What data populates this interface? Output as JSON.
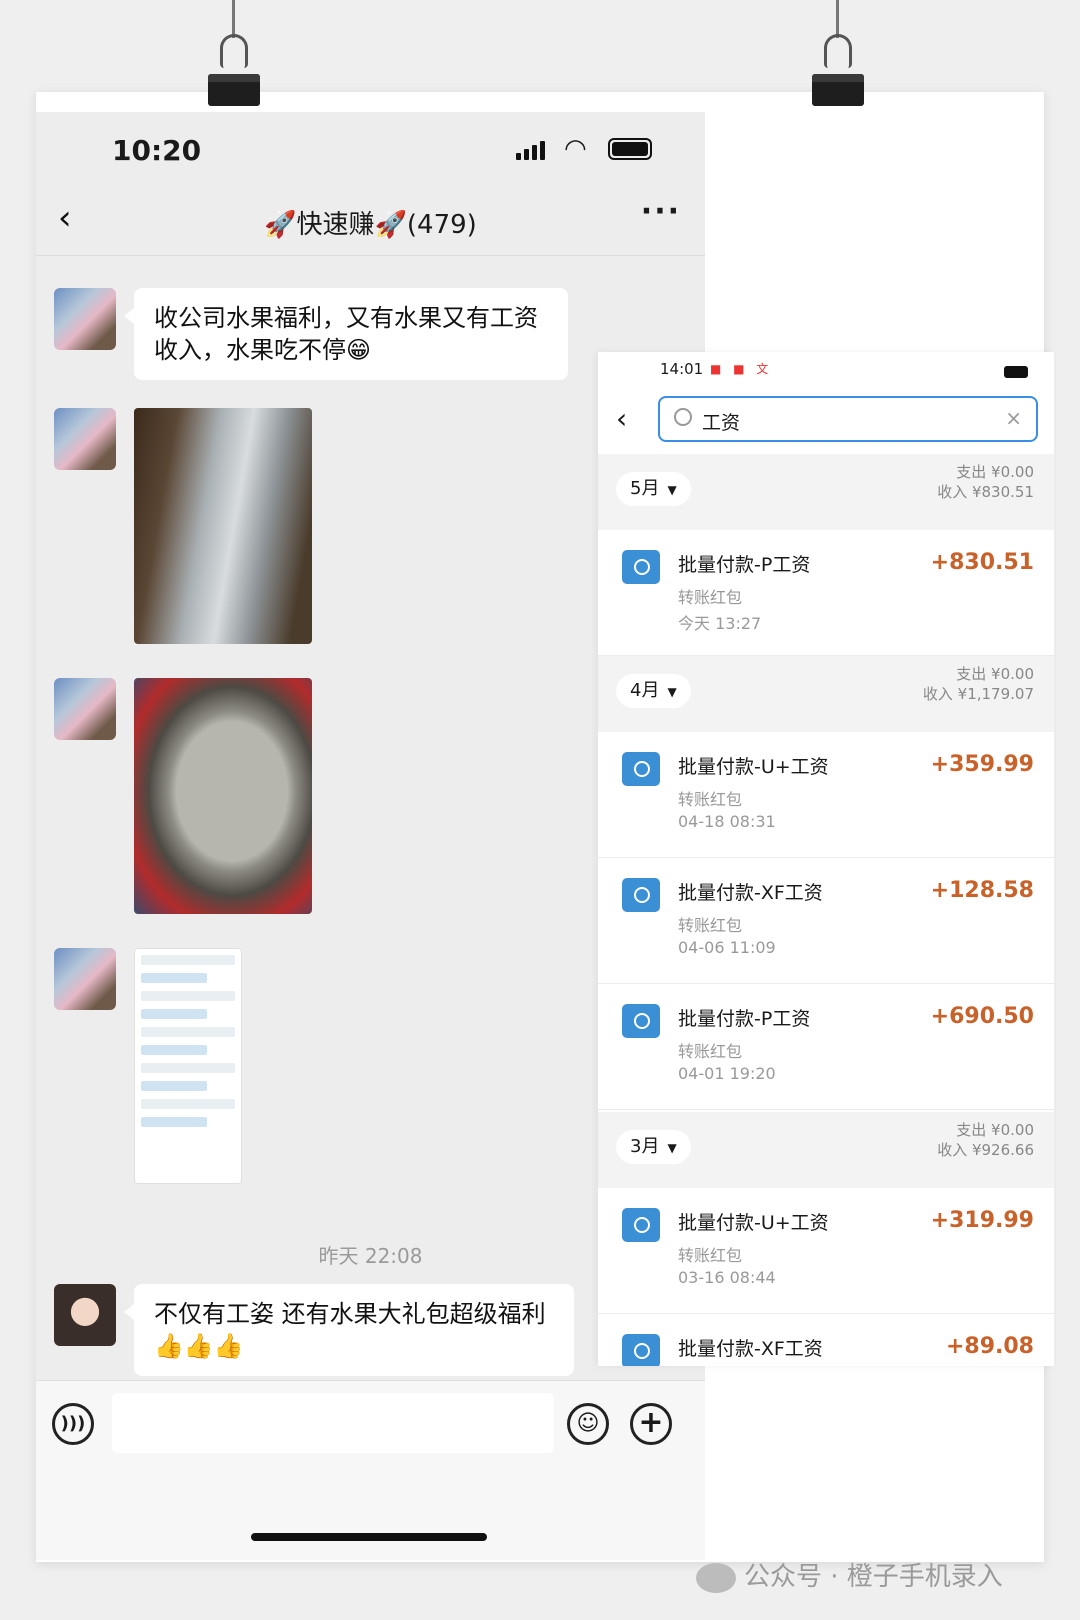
{
  "chat": {
    "status_time": "10:20",
    "group_title": "🚀快速赚🚀(479)",
    "messages": [
      {
        "text": "收公司水果福利，又有水果又有工资收入，水果吃不停😁"
      },
      {
        "text": "不仅有工姿 还有水果大礼包超级福利👍👍👍"
      }
    ],
    "timestamp": "昨天 22:08"
  },
  "wallet": {
    "status_time": "14:01",
    "search_value": "工资",
    "months": [
      {
        "label": "5月",
        "expense": "支出 ¥0.00",
        "income": "收入 ¥830.51"
      },
      {
        "label": "4月",
        "expense": "支出 ¥0.00",
        "income": "收入 ¥1,179.07"
      },
      {
        "label": "3月",
        "expense": "支出 ¥0.00",
        "income": "收入 ¥926.66"
      }
    ],
    "transactions": [
      {
        "name": "批量付款-P工资",
        "type": "转账红包",
        "date": "今天 13:27",
        "amount": "+830.51"
      },
      {
        "name": "批量付款-U+工资",
        "type": "转账红包",
        "date": "04-18 08:31",
        "amount": "+359.99"
      },
      {
        "name": "批量付款-XF工资",
        "type": "转账红包",
        "date": "04-06 11:09",
        "amount": "+128.58"
      },
      {
        "name": "批量付款-P工资",
        "type": "转账红包",
        "date": "04-01 19:20",
        "amount": "+690.50"
      },
      {
        "name": "批量付款-U+工资",
        "type": "转账红包",
        "date": "03-16 08:44",
        "amount": "+319.99"
      },
      {
        "name": "批量付款-XF工资",
        "type": "",
        "date": "",
        "amount": "+89.08"
      }
    ]
  },
  "watermark": "公众号 · 橙子手机录入",
  "icons": {
    "back": "chevron-left-icon",
    "more": "more-dots-icon",
    "voice": "voice-icon",
    "emoji": "emoji-icon",
    "plus": "plus-icon",
    "search": "search-icon",
    "clear": "close-icon"
  },
  "colors": {
    "amount": "#c9622a",
    "accent": "#3a8ee6",
    "chat_bg": "#ededed"
  }
}
